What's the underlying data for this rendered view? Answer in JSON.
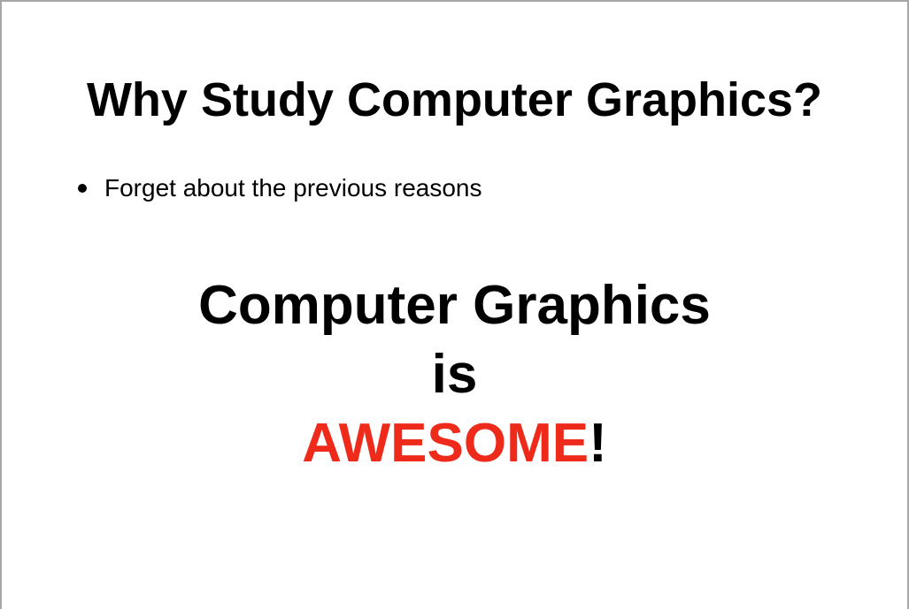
{
  "slide": {
    "title": "Why Study Computer Graphics?",
    "bullets": [
      "Forget about the previous reasons"
    ],
    "statement": {
      "line1": "Computer Graphics",
      "line2": "is",
      "highlight": "AWESOME",
      "punctuation": "!"
    }
  },
  "colors": {
    "highlight": "#ee2a1b",
    "text": "#000000",
    "background": "#ffffff"
  }
}
